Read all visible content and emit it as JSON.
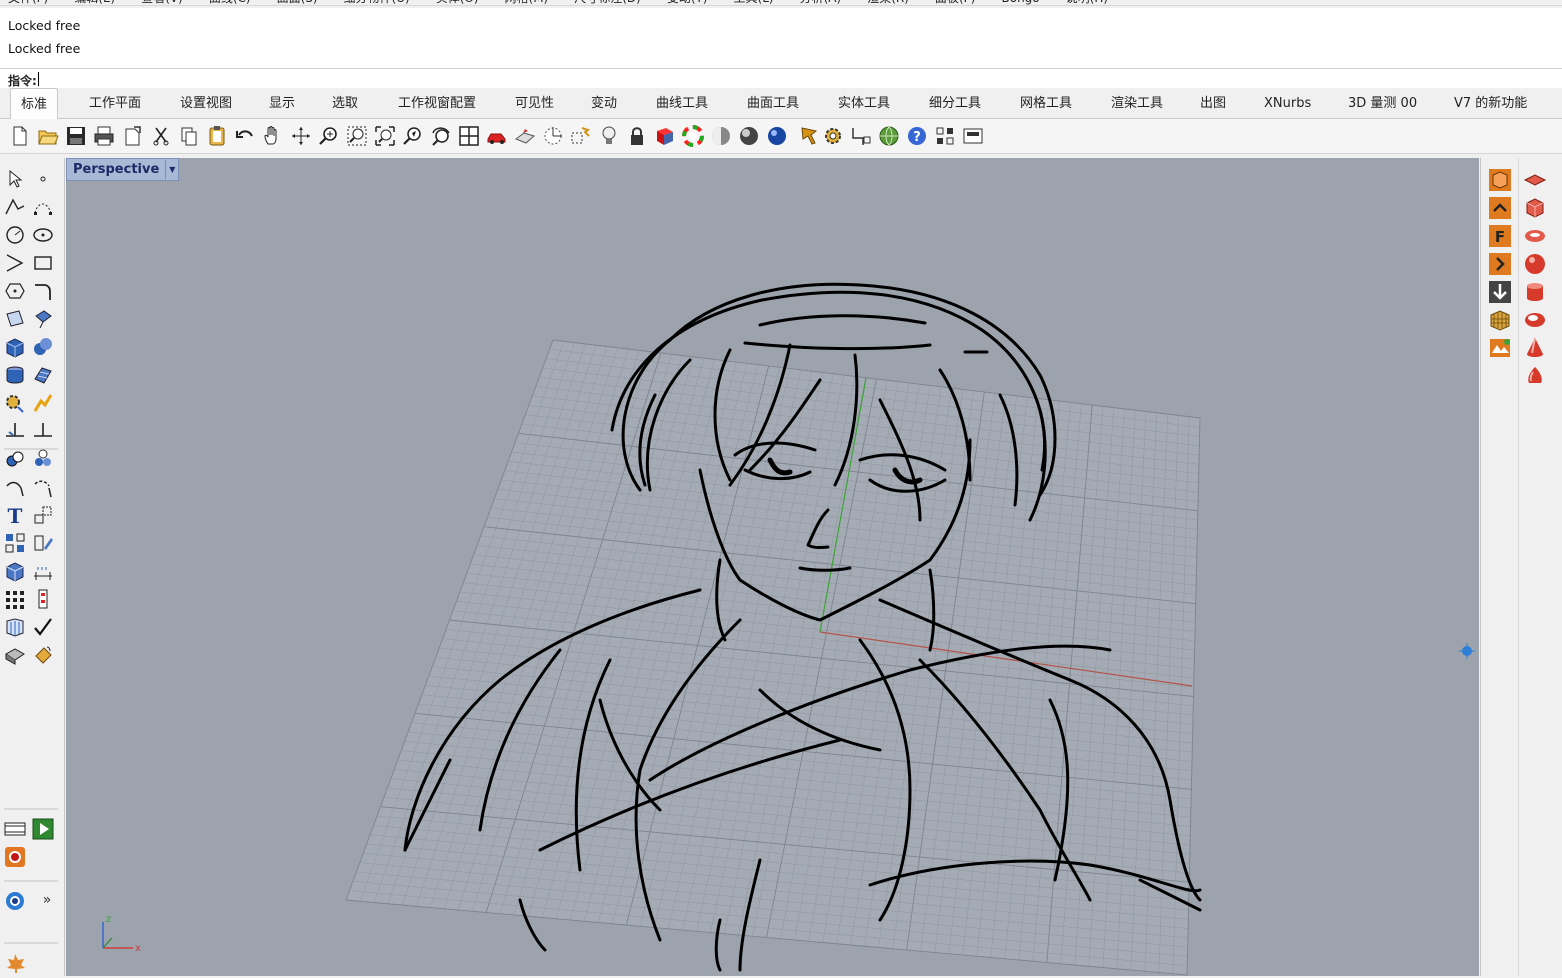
{
  "menubar": {
    "items": [
      "文件(F)",
      "编辑(E)",
      "查看(V)",
      "曲线(C)",
      "曲面(S)",
      "细分物件(U)",
      "实体(O)",
      "网格(M)",
      "尺寸标注(D)",
      "变动(T)",
      "工具(L)",
      "分析(A)",
      "渲染(R)",
      "面板(P)",
      "Bongo",
      "说明(H)"
    ]
  },
  "command": {
    "history": [
      "Locked free",
      "Locked free"
    ],
    "prompt_label": "指令:",
    "input_value": ""
  },
  "tabs": [
    "标准",
    "工作平面",
    "设置视图",
    "显示",
    "选取",
    "工作视窗配置",
    "可见性",
    "变动",
    "曲线工具",
    "曲面工具",
    "实体工具",
    "细分工具",
    "网格工具",
    "渲染工具",
    "出图",
    "XNurbs",
    "3D 量测 00",
    "V7 的新功能"
  ],
  "active_tab": "标准",
  "toolbar_icons": [
    "new-file-icon",
    "open-folder-icon",
    "save-icon",
    "print-icon",
    "import-icon",
    "cut-icon",
    "copy-icon",
    "paste-icon",
    "undo-icon",
    "pan-hand-icon",
    "rotate-view-icon",
    "zoom-icon",
    "zoom-window-icon",
    "zoom-extents-icon",
    "zoom-selected-icon",
    "undo-view-icon",
    "four-viewports-icon",
    "car-icon",
    "plane-icon",
    "cplane-icon",
    "select-icon",
    "light-icon",
    "lock-icon",
    "material-icon",
    "color-wheel-icon",
    "shaded-sphere-icon",
    "rendered-sphere-icon",
    "blue-sphere-icon",
    "render-icon",
    "settings-gear-icon",
    "dimension-icon",
    "globe-icon",
    "help-icon",
    "grid-snap-icon",
    "named-views-icon"
  ],
  "viewport": {
    "name": "Perspective",
    "axis_labels": {
      "z": "z",
      "x": "x"
    }
  },
  "colors": {
    "viewport_bg": "#9ca3ad",
    "grid_line": "#8b929c",
    "x_axis": "#b4534b",
    "y_axis": "#3ea337",
    "title_bg": "#a8b9d6",
    "accent_orange": "#e07a1f"
  }
}
